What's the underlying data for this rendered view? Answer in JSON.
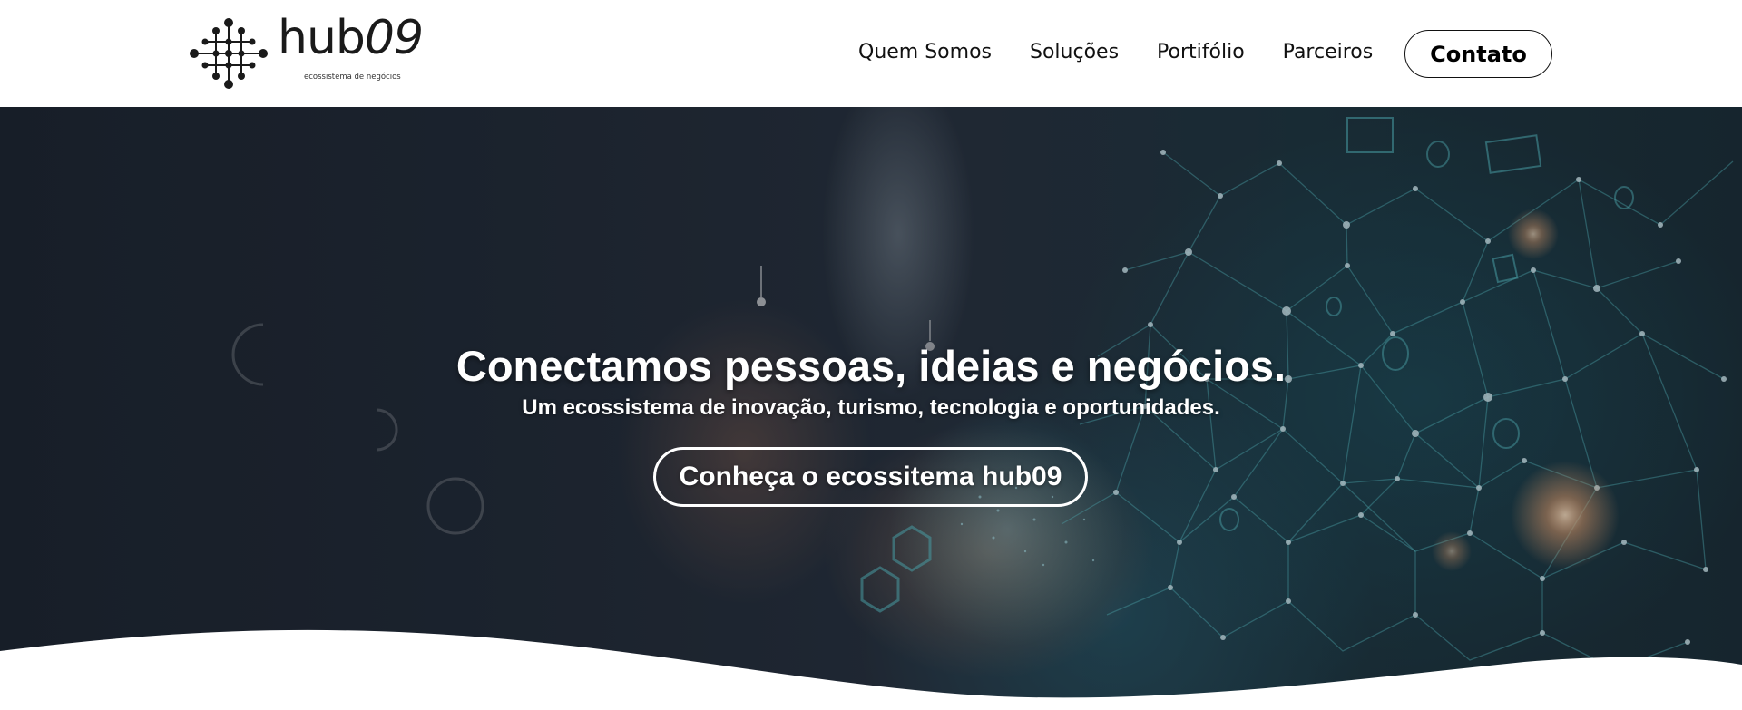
{
  "brand": {
    "name": "hub",
    "name_num": "09",
    "tagline": "ecossistema de negócios",
    "logo_icon": "molecule-network-icon"
  },
  "nav": {
    "items": [
      {
        "label": "Quem Somos"
      },
      {
        "label": "Soluções"
      },
      {
        "label": "Portifólio"
      },
      {
        "label": "Parceiros"
      }
    ],
    "contact_label": "Contato"
  },
  "hero": {
    "title": "Conectamos pessoas, ideias e negócios.",
    "subtitle": "Um ecossistema de inovação, turismo, tecnologia e oportunidades.",
    "cta_label": "Conheça o ecossitema hub09"
  },
  "colors": {
    "header_bg": "#ffffff",
    "text_dark": "#111111",
    "hero_text": "#ffffff",
    "network_accent": "#5fd1d8",
    "glow_accent": "#ffb27a"
  }
}
